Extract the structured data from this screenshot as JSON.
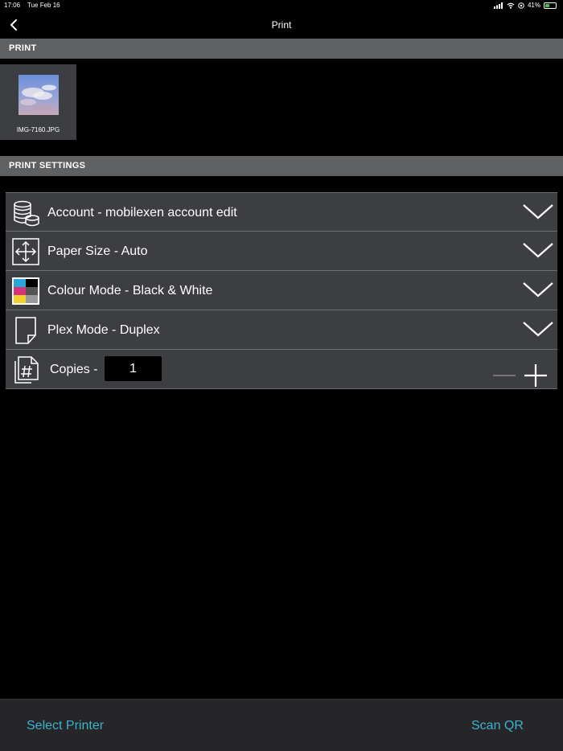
{
  "status": {
    "time": "17:06",
    "date": "Tue Feb 16",
    "battery_percent": "41%",
    "battery_level": 0.41
  },
  "nav": {
    "title": "Print",
    "back_icon": "chevron-left-icon"
  },
  "print_section": {
    "header": "PRINT",
    "files": [
      {
        "name": "IMG-7160.JPG"
      }
    ]
  },
  "settings_section": {
    "header": "PRINT SETTINGS",
    "rows": [
      {
        "label": "Account - mobilexen account edit",
        "icon": "coins-icon"
      },
      {
        "label": "Paper Size - Auto",
        "icon": "resize-arrows-icon"
      },
      {
        "label": "Colour Mode - Black & White",
        "icon": "color-swatch-icon"
      },
      {
        "label": "Plex Mode - Duplex",
        "icon": "page-icon"
      }
    ],
    "copies": {
      "label": "Copies -",
      "value": "1",
      "icon": "copies-hash-icon"
    }
  },
  "bottom_bar": {
    "select_printer": "Select Printer",
    "scan_qr": "Scan QR"
  },
  "colors": {
    "accent": "#3ab3cf",
    "header_bg": "#5f6062",
    "row_bg": "#3d3e41",
    "bottom_bg": "#262628"
  }
}
